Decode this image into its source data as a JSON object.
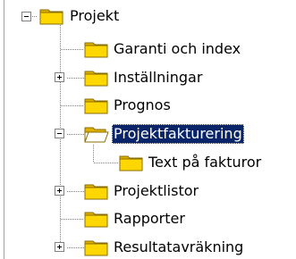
{
  "tree": {
    "root": {
      "label": "Projekt",
      "icon": "folder-closed-icon",
      "expanded": true
    },
    "items": [
      {
        "label": "Garanti och index",
        "icon": "folder-closed-icon",
        "expander": "none"
      },
      {
        "label": "Inställningar",
        "icon": "folder-closed-icon",
        "expander": "plus"
      },
      {
        "label": "Prognos",
        "icon": "folder-closed-icon",
        "expander": "none"
      },
      {
        "label": "Projektfakturering",
        "icon": "folder-open-icon",
        "expander": "minus",
        "selected": true,
        "children": [
          {
            "label": "Text på fakturor",
            "icon": "folder-closed-icon",
            "expander": "none"
          }
        ]
      },
      {
        "label": "Projektlistor",
        "icon": "folder-closed-icon",
        "expander": "plus"
      },
      {
        "label": "Rapporter",
        "icon": "folder-closed-icon",
        "expander": "none"
      },
      {
        "label": "Resultatavräkning",
        "icon": "folder-closed-icon",
        "expander": "plus"
      }
    ]
  },
  "colors": {
    "folder_fill": "#ffd700",
    "folder_shade": "#e0b000",
    "folder_outline": "#8a6d00",
    "selection_bg": "#0a246a",
    "selection_text": "#ffffff",
    "tree_lines": "#808080"
  }
}
